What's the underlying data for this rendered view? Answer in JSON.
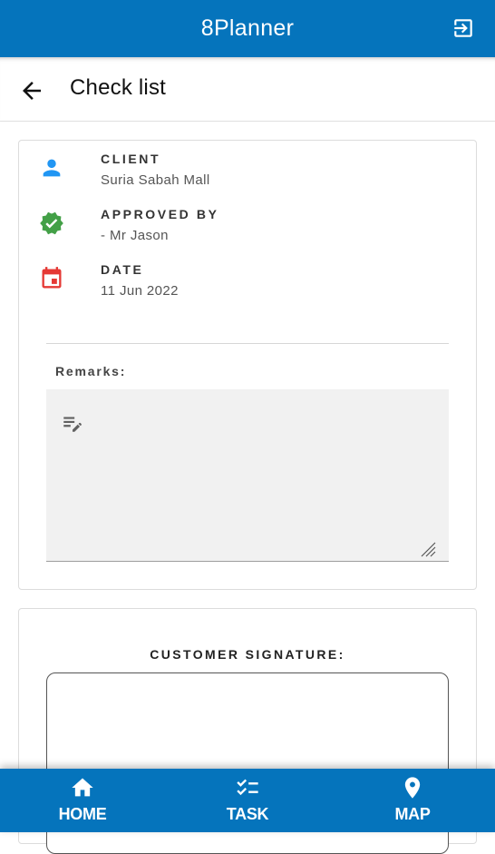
{
  "app": {
    "title": "8Planner"
  },
  "header": {
    "page_title": "Check list"
  },
  "details": {
    "client": {
      "label": "CLIENT",
      "value": "Suria Sabah Mall",
      "icon": "person-icon",
      "color": "#2196f3"
    },
    "approved_by": {
      "label": "APPROVED BY",
      "value": "- Mr Jason",
      "icon": "verified-icon",
      "color": "#43a047"
    },
    "date": {
      "label": "DATE",
      "value": "11 Jun 2022",
      "icon": "calendar-icon",
      "color": "#e53935"
    }
  },
  "remarks": {
    "label": "Remarks:",
    "value": ""
  },
  "signature": {
    "label": "CUSTOMER SIGNATURE:"
  },
  "nav": {
    "items": [
      {
        "label": "HOME",
        "icon": "home-icon"
      },
      {
        "label": "TASK",
        "icon": "checklist-icon"
      },
      {
        "label": "MAP",
        "icon": "map-pin-icon"
      }
    ]
  },
  "colors": {
    "primary": "#0574bc",
    "remarks_bg": "#f1f1f1"
  }
}
